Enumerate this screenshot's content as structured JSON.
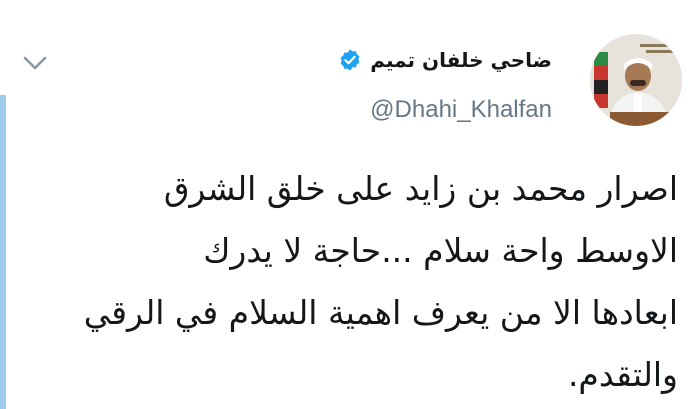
{
  "tweet": {
    "author": {
      "display_name": "ضاحي خلفان تميم",
      "handle": "@Dhahi_Khalfan",
      "verified": true,
      "avatar_icon": "profile-photo"
    },
    "text_lines": [
      "اصرار محمد بن زايد على خلق الشرق",
      "الاوسط واحة سلام ...حاجة  لا يدرك",
      "ابعادها الا من يعرف اهمية السلام في الرقي",
      "والتقدم."
    ]
  },
  "colors": {
    "accent": "#1da1f2",
    "handle": "#657786",
    "text": "#14171a",
    "left_bar": "#9ecbec"
  }
}
